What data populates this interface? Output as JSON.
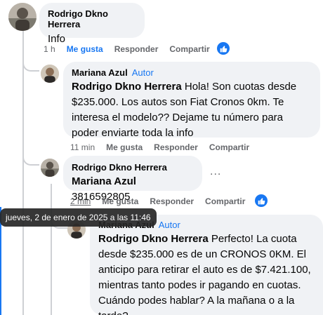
{
  "comments": [
    {
      "author": "Rodrigo Dkno Herrera",
      "text": "Info",
      "time": "1 h",
      "like": "Me gusta",
      "reply": "Responder",
      "share": "Compartir"
    },
    {
      "author": "Mariana Azul",
      "badge": "Autor",
      "mention": "Rodrigo Dkno Herrera",
      "text": " Hola! Son cuotas desde $235.000. Los autos son Fiat Cronos 0km. Te interesa el modelo?? Dejame tu número para poder enviarte toda la info",
      "time": "11 min",
      "like": "Me gusta",
      "reply": "Responder",
      "share": "Compartir"
    },
    {
      "author": "Rodrigo Dkno Herrera",
      "mention": "Mariana Azul",
      "text": " 3816592805",
      "time": "2 min",
      "like": "Me gusta",
      "reply": "Responder",
      "share": "Compartir"
    },
    {
      "author": "Mariana Azul",
      "badge": "Autor",
      "mention": "Rodrigo Dkno Herrera",
      "text": " Perfecto! La cuota desde $235.000 es de un CRONOS 0KM. El anticipo para retirar el auto es de $7.421.100, mientras tanto podes ir pagando en cuotas. Cuándo podes hablar? A la mañana o a la tarde?"
    }
  ],
  "more_options": "...",
  "tooltip": "jueves, 2 de enero de 2025 a las 11:46",
  "colors": {
    "accent": "#1877f2",
    "bubble": "#f0f2f5",
    "secondary_text": "#65676b"
  },
  "icons": {
    "reaction": "like-thumb-icon",
    "more": "more-dots-icon"
  }
}
